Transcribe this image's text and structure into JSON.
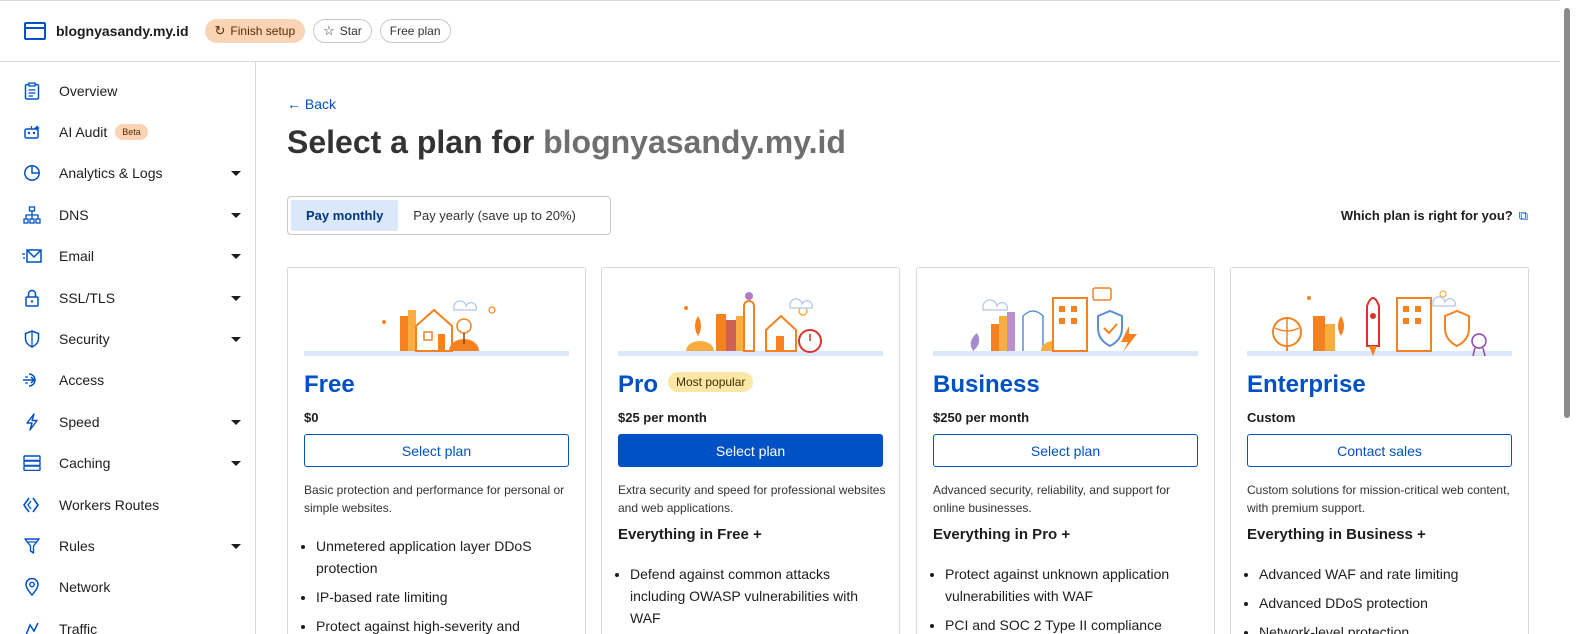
{
  "topbar": {
    "site_name": "blognyasandy.my.id",
    "finish_setup": "Finish setup",
    "star": "Star",
    "plan_badge": "Free plan"
  },
  "sidebar": {
    "items": [
      {
        "label": "Overview",
        "icon": "clipboard-icon"
      },
      {
        "label": "AI Audit",
        "icon": "robot-icon",
        "badge": "Beta"
      },
      {
        "label": "Analytics & Logs",
        "icon": "pie-chart-icon"
      },
      {
        "label": "DNS",
        "icon": "network-tree-icon"
      },
      {
        "label": "Email",
        "icon": "envelope-icon"
      },
      {
        "label": "SSL/TLS",
        "icon": "lock-icon"
      },
      {
        "label": "Security",
        "icon": "shield-icon"
      },
      {
        "label": "Access",
        "icon": "access-icon"
      },
      {
        "label": "Speed",
        "icon": "lightning-icon"
      },
      {
        "label": "Caching",
        "icon": "server-stack-icon"
      },
      {
        "label": "Workers Routes",
        "icon": "workers-icon"
      },
      {
        "label": "Rules",
        "icon": "funnel-icon"
      },
      {
        "label": "Network",
        "icon": "location-pin-icon"
      },
      {
        "label": "Traffic",
        "icon": "traffic-icon"
      }
    ]
  },
  "main": {
    "back": "Back",
    "title_prefix": "Select a plan for",
    "title_domain": "blognyasandy.my.id",
    "billing": {
      "monthly": "Pay monthly",
      "yearly": "Pay yearly (save up to 20%)"
    },
    "which_plan": "Which plan is right for you?"
  },
  "plans": [
    {
      "name": "Free",
      "price": "$0",
      "button": "Select plan",
      "description": "Basic protection and performance for personal or simple websites.",
      "features": [
        "Unmetered application layer DDoS protection",
        "IP-based rate limiting",
        "Protect against high-severity and"
      ]
    },
    {
      "name": "Pro",
      "badge": "Most popular",
      "price": "$25 per month",
      "button": "Select plan",
      "description": "Extra security and speed for professional websites and web applications.",
      "everything": "Everything in Free +",
      "features": [
        "Defend against common attacks including OWASP vulnerabilities with WAF"
      ]
    },
    {
      "name": "Business",
      "price": "$250 per month",
      "button": "Select plan",
      "description": "Advanced security, reliability, and support for online businesses.",
      "everything": "Everything in Pro +",
      "features": [
        "Protect against unknown application vulnerabilities with WAF",
        "PCI and SOC 2 Type II compliance"
      ]
    },
    {
      "name": "Enterprise",
      "price": "Custom",
      "button": "Contact sales",
      "description": "Custom solutions for mission-critical web content, with premium support.",
      "everything": "Everything in Business +",
      "features": [
        "Advanced WAF and rate limiting",
        "Advanced DDoS protection",
        "Network-level protection"
      ]
    }
  ],
  "colors": {
    "accent": "#0051c3",
    "badge_orange": "#fbd4b5",
    "badge_yellow": "#fbe7a6",
    "illustration_orange": "#f6821f"
  }
}
